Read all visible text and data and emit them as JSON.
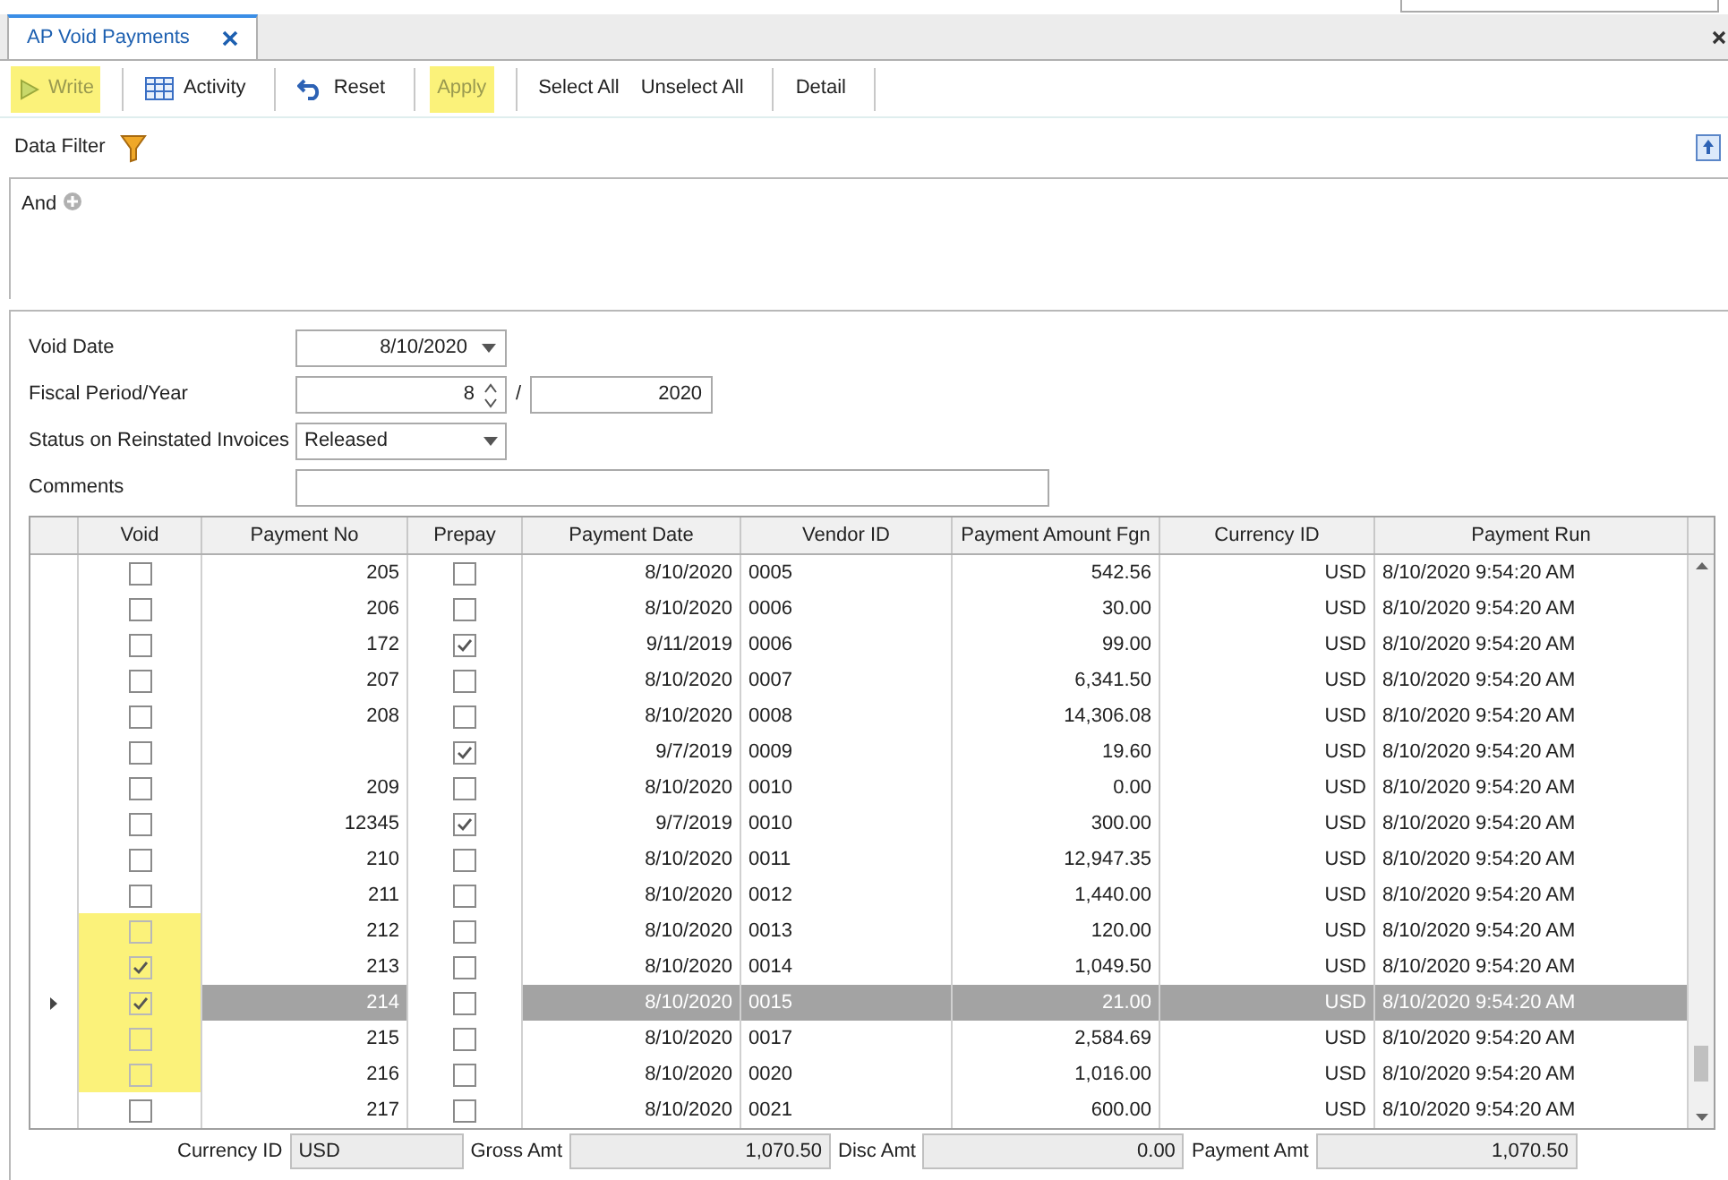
{
  "tab": {
    "title": "AP Void Payments",
    "selected": true
  },
  "toolbar": [
    {
      "label": "Write",
      "highlighted": true,
      "disabled": true
    },
    {
      "label": "Activity",
      "highlighted": false,
      "disabled": false
    },
    {
      "label": "Reset",
      "highlighted": false,
      "disabled": false
    },
    {
      "label": "Apply",
      "highlighted": true,
      "disabled": true
    },
    {
      "label": "Select All",
      "highlighted": false,
      "disabled": false
    },
    {
      "label": "Unselect All",
      "highlighted": false,
      "disabled": false
    },
    {
      "label": "Detail",
      "highlighted": false,
      "disabled": false
    }
  ],
  "data_filter": {
    "label": "Data Filter",
    "operator": "And"
  },
  "form": {
    "void_date": {
      "label": "Void Date",
      "value": "8/10/2020"
    },
    "fiscal": {
      "label": "Fiscal Period/Year",
      "period": "8",
      "separator": "/",
      "year": "2020"
    },
    "status": {
      "label": "Status on Reinstated Invoices",
      "value": "Released"
    },
    "comments": {
      "label": "Comments"
    }
  },
  "table": {
    "columns": [
      "Void",
      "Payment No",
      "Prepay",
      "Payment Date",
      "Vendor ID",
      "Payment Amount Fgn",
      "Currency ID",
      "Payment Run"
    ],
    "rows": [
      {
        "void": false,
        "highlighted": false,
        "selected": false,
        "payment_no": "205",
        "prepay": false,
        "payment_date": "8/10/2020",
        "vendor_id": "0005",
        "amount": "542.56",
        "currency": "USD",
        "payment_run": "8/10/2020 9:54:20 AM"
      },
      {
        "void": false,
        "highlighted": false,
        "selected": false,
        "payment_no": "206",
        "prepay": false,
        "payment_date": "8/10/2020",
        "vendor_id": "0006",
        "amount": "30.00",
        "currency": "USD",
        "payment_run": "8/10/2020 9:54:20 AM"
      },
      {
        "void": false,
        "highlighted": false,
        "selected": false,
        "payment_no": "172",
        "prepay": true,
        "payment_date": "9/11/2019",
        "vendor_id": "0006",
        "amount": "99.00",
        "currency": "USD",
        "payment_run": "8/10/2020 9:54:20 AM"
      },
      {
        "void": false,
        "highlighted": false,
        "selected": false,
        "payment_no": "207",
        "prepay": false,
        "payment_date": "8/10/2020",
        "vendor_id": "0007",
        "amount": "6,341.50",
        "currency": "USD",
        "payment_run": "8/10/2020 9:54:20 AM"
      },
      {
        "void": false,
        "highlighted": false,
        "selected": false,
        "payment_no": "208",
        "prepay": false,
        "payment_date": "8/10/2020",
        "vendor_id": "0008",
        "amount": "14,306.08",
        "currency": "USD",
        "payment_run": "8/10/2020 9:54:20 AM"
      },
      {
        "void": false,
        "highlighted": false,
        "selected": false,
        "prepay": true,
        "payment_date": "9/7/2019",
        "vendor_id": "0009",
        "amount": "19.60",
        "currency": "USD",
        "payment_run": "8/10/2020 9:54:20 AM"
      },
      {
        "void": false,
        "highlighted": false,
        "selected": false,
        "payment_no": "209",
        "prepay": false,
        "payment_date": "8/10/2020",
        "vendor_id": "0010",
        "amount": "0.00",
        "currency": "USD",
        "payment_run": "8/10/2020 9:54:20 AM"
      },
      {
        "void": false,
        "highlighted": false,
        "selected": false,
        "payment_no": "12345",
        "prepay": true,
        "payment_date": "9/7/2019",
        "vendor_id": "0010",
        "amount": "300.00",
        "currency": "USD",
        "payment_run": "8/10/2020 9:54:20 AM"
      },
      {
        "void": false,
        "highlighted": false,
        "selected": false,
        "payment_no": "210",
        "prepay": false,
        "payment_date": "8/10/2020",
        "vendor_id": "0011",
        "amount": "12,947.35",
        "currency": "USD",
        "payment_run": "8/10/2020 9:54:20 AM"
      },
      {
        "void": false,
        "highlighted": false,
        "selected": false,
        "payment_no": "211",
        "prepay": false,
        "payment_date": "8/10/2020",
        "vendor_id": "0012",
        "amount": "1,440.00",
        "currency": "USD",
        "payment_run": "8/10/2020 9:54:20 AM"
      },
      {
        "void": false,
        "highlighted": true,
        "selected": false,
        "payment_no": "212",
        "prepay": false,
        "payment_date": "8/10/2020",
        "vendor_id": "0013",
        "amount": "120.00",
        "currency": "USD",
        "payment_run": "8/10/2020 9:54:20 AM"
      },
      {
        "void": true,
        "highlighted": true,
        "selected": false,
        "payment_no": "213",
        "prepay": false,
        "payment_date": "8/10/2020",
        "vendor_id": "0014",
        "amount": "1,049.50",
        "currency": "USD",
        "payment_run": "8/10/2020 9:54:20 AM"
      },
      {
        "void": true,
        "highlighted": true,
        "selected": true,
        "payment_no": "214",
        "prepay": false,
        "payment_date": "8/10/2020",
        "vendor_id": "0015",
        "amount": "21.00",
        "currency": "USD",
        "payment_run": "8/10/2020 9:54:20 AM"
      },
      {
        "void": false,
        "highlighted": true,
        "selected": false,
        "payment_no": "215",
        "prepay": false,
        "payment_date": "8/10/2020",
        "vendor_id": "0017",
        "amount": "2,584.69",
        "currency": "USD",
        "payment_run": "8/10/2020 9:54:20 AM"
      },
      {
        "void": false,
        "highlighted": true,
        "selected": false,
        "payment_no": "216",
        "prepay": false,
        "payment_date": "8/10/2020",
        "vendor_id": "0020",
        "amount": "1,016.00",
        "currency": "USD",
        "payment_run": "8/10/2020 9:54:20 AM"
      },
      {
        "void": false,
        "highlighted": false,
        "selected": false,
        "payment_no": "217",
        "prepay": false,
        "payment_date": "8/10/2020",
        "vendor_id": "0021",
        "amount": "600.00",
        "currency": "USD",
        "payment_run": "8/10/2020 9:54:20 AM"
      }
    ]
  },
  "totals": [
    {
      "label": "Currency ID",
      "value": "USD"
    },
    {
      "label": "Gross Amt",
      "value": "1,070.50"
    },
    {
      "label": "Disc Amt",
      "value": "0.00"
    },
    {
      "label": "Payment Amt",
      "value": "1,070.50"
    }
  ]
}
